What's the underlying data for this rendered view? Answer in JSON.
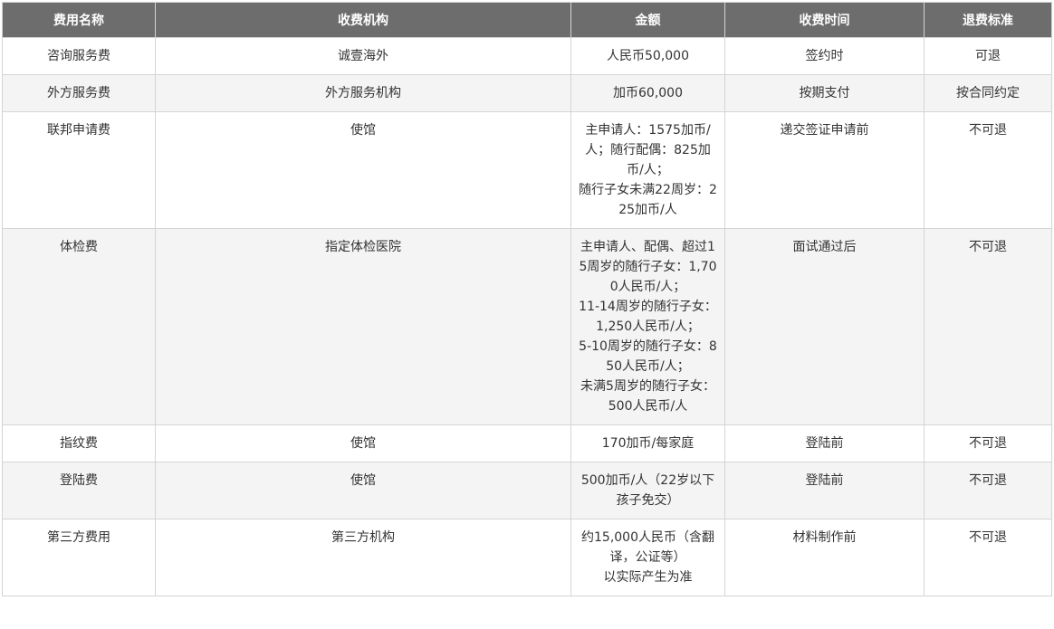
{
  "headers": [
    "费用名称",
    "收费机构",
    "金额",
    "收费时间",
    "退费标准"
  ],
  "rows": [
    {
      "name": "咨询服务费",
      "org": "诚壹海外",
      "amount": [
        "人民币50,000"
      ],
      "time": "签约时",
      "refund": "可退"
    },
    {
      "name": "外方服务费",
      "org": "外方服务机构",
      "amount": [
        "加币60,000"
      ],
      "time": "按期支付",
      "refund": "按合同约定"
    },
    {
      "name": "联邦申请费",
      "org": "使馆",
      "amount": [
        "主申请人：1575加币/人；随行配偶：825加币/人；",
        "随行子女未满22周岁：225加币/人"
      ],
      "time": "递交签证申请前",
      "refund": "不可退"
    },
    {
      "name": "体检费",
      "org": "指定体检医院",
      "amount": [
        "主申请人、配偶、超过15周岁的随行子女：1,700人民币/人；",
        "11-14周岁的随行子女：1,250人民币/人；",
        "5-10周岁的随行子女：850人民币/人；",
        "未满5周岁的随行子女：500人民币/人"
      ],
      "time": "面试通过后",
      "refund": "不可退"
    },
    {
      "name": "指纹费",
      "org": "使馆",
      "amount": [
        "170加币/每家庭"
      ],
      "time": "登陆前",
      "refund": "不可退"
    },
    {
      "name": "登陆费",
      "org": "使馆",
      "amount": [
        "500加币/人（22岁以下孩子免交）"
      ],
      "time": "登陆前",
      "refund": "不可退"
    },
    {
      "name": "第三方费用",
      "org": "第三方机构",
      "amount": [
        "约15,000人民币（含翻译，公证等）",
        "以实际产生为准"
      ],
      "time": "材料制作前",
      "refund": "不可退"
    }
  ]
}
